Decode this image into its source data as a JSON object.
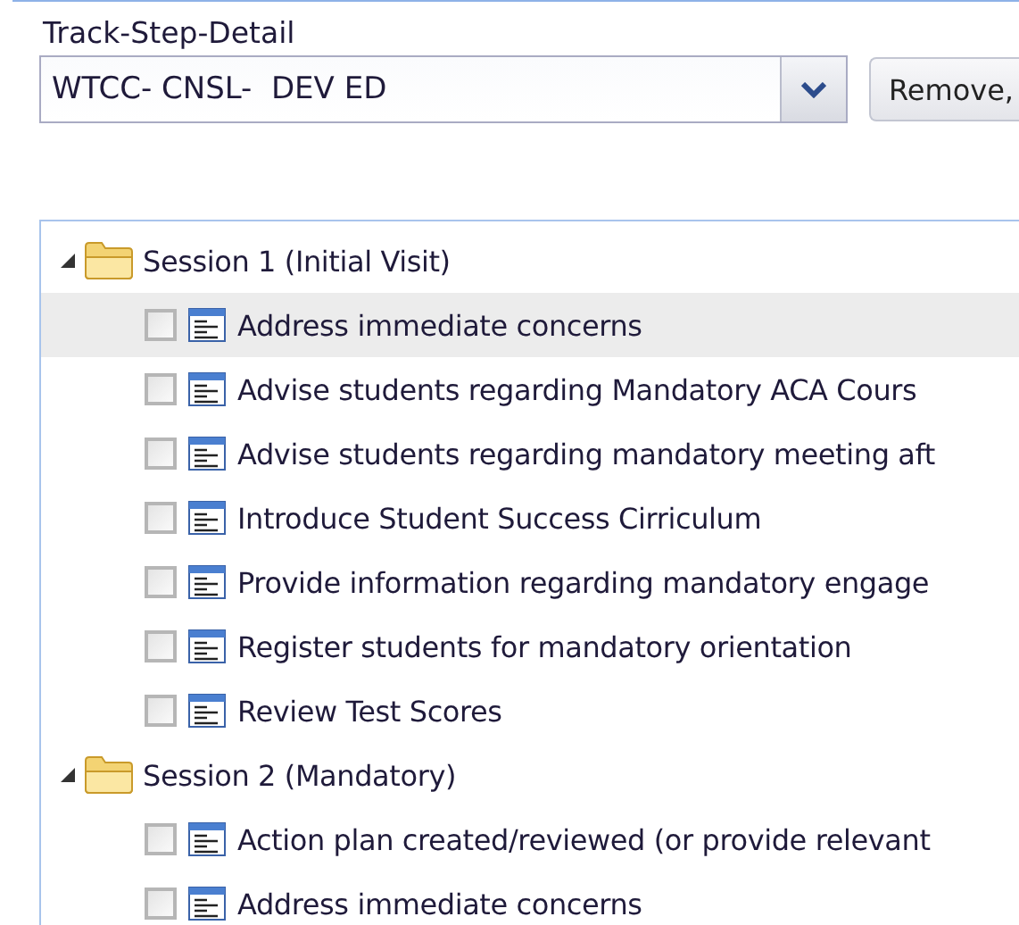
{
  "field": {
    "label": "Track-Step-Detail",
    "value": "WTCC- CNSL-  DEV ED"
  },
  "remove_button": {
    "label": "Remove,"
  },
  "tree": [
    {
      "label": "Session 1 (Initial Visit)",
      "expanded": true,
      "children": [
        {
          "label": "Address immediate concerns",
          "checked": false,
          "selected": true
        },
        {
          "label": "Advise students regarding Mandatory ACA Cours",
          "checked": false,
          "selected": false
        },
        {
          "label": "Advise students regarding mandatory meeting aft",
          "checked": false,
          "selected": false
        },
        {
          "label": "Introduce Student Success Cirriculum",
          "checked": false,
          "selected": false
        },
        {
          "label": "Provide information regarding mandatory engage",
          "checked": false,
          "selected": false
        },
        {
          "label": "Register students for mandatory orientation",
          "checked": false,
          "selected": false
        },
        {
          "label": "Review Test Scores",
          "checked": false,
          "selected": false
        }
      ]
    },
    {
      "label": "Session 2 (Mandatory)",
      "expanded": true,
      "children": [
        {
          "label": "Action plan created/reviewed (or provide relevant",
          "checked": false,
          "selected": false
        },
        {
          "label": "Address immediate concerns",
          "checked": false,
          "selected": false
        }
      ]
    }
  ]
}
